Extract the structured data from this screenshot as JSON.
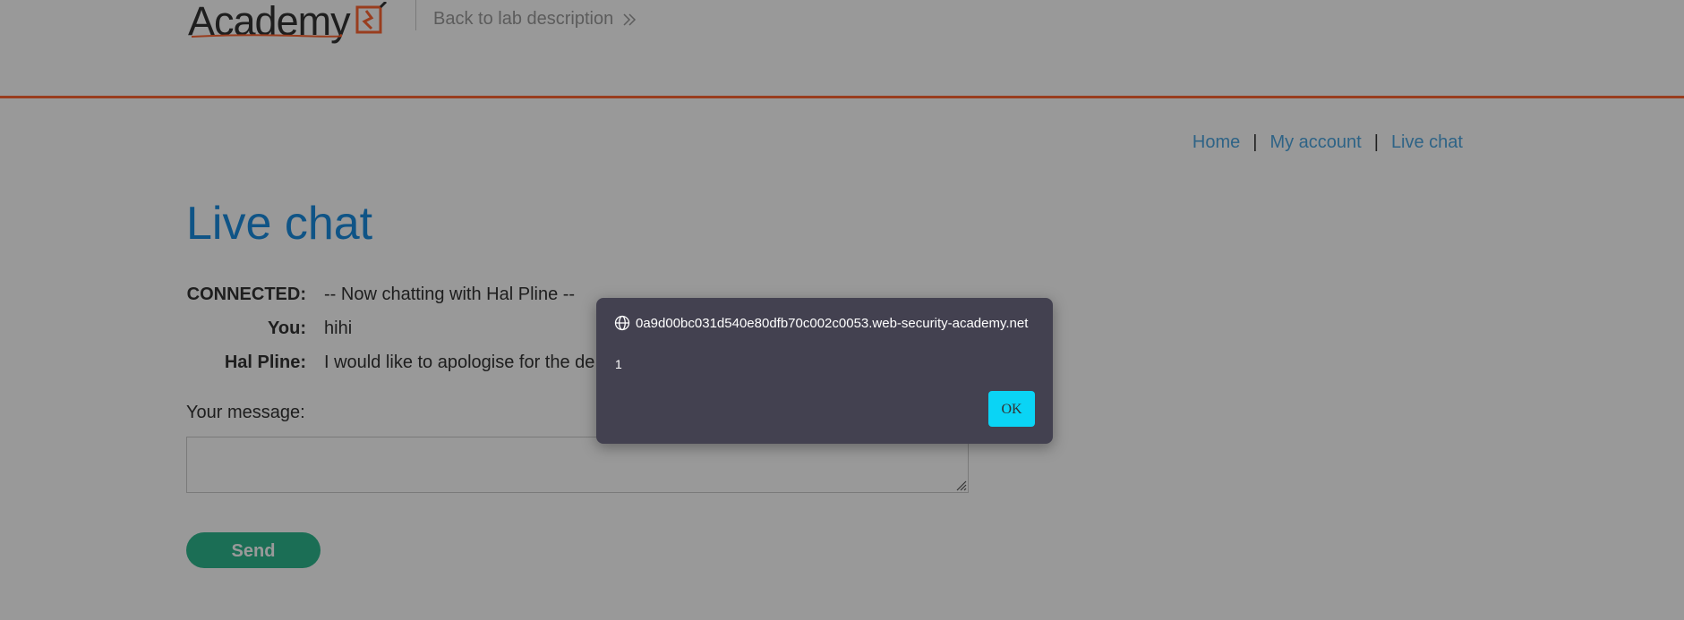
{
  "header": {
    "logo_text": "Academy",
    "back_link": "Back to lab description"
  },
  "nav": {
    "items": [
      {
        "label": "Home"
      },
      {
        "label": "My account"
      },
      {
        "label": "Live chat"
      }
    ],
    "separator": "|"
  },
  "main": {
    "title": "Live chat",
    "chat": [
      {
        "who": "CONNECTED:",
        "message": "-- Now chatting with Hal Pline --"
      },
      {
        "who": "You:",
        "message": "hihi"
      },
      {
        "who": "Hal Pline:",
        "message": "I would like to apologise for the de"
      }
    ],
    "message_label": "Your message:",
    "message_value": "",
    "send_label": "Send"
  },
  "dialog": {
    "origin": "0a9d00bc031d540e80dfb70c002c0053.web-security-academy.net",
    "message": "1",
    "ok_label": "OK",
    "icon": "globe-icon"
  },
  "colors": {
    "accent_orange": "#ff6633",
    "link_blue": "#4da6e0",
    "title_blue": "#1a8ce0",
    "send_green": "#2db88e",
    "dialog_bg": "#434150",
    "ok_cyan": "#0ad4f5"
  }
}
